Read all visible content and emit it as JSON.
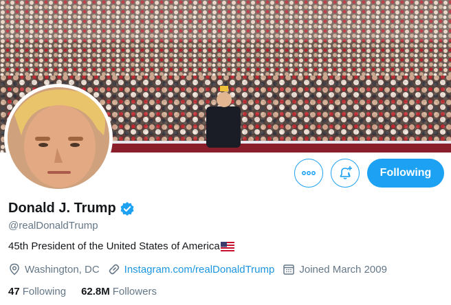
{
  "profile": {
    "display_name": "Donald J. Trump",
    "handle": "@realDonaldTrump",
    "verified": true,
    "bio": "45th President of the United States of America",
    "bio_emoji": "us-flag-emoji",
    "location": "Washington, DC",
    "website": "Instagram.com/realDonaldTrump",
    "joined": "Joined March 2009"
  },
  "stats": {
    "following_count": "47",
    "following_label": "Following",
    "followers_count": "62.8M",
    "followers_label": "Followers"
  },
  "actions": {
    "more_icon": "more-icon",
    "notify_icon": "bell-plus-icon",
    "follow_label": "Following"
  },
  "colors": {
    "accent": "#1da1f2",
    "link": "#1b95e0",
    "secondary_text": "#657786",
    "primary_text": "#14171a"
  }
}
